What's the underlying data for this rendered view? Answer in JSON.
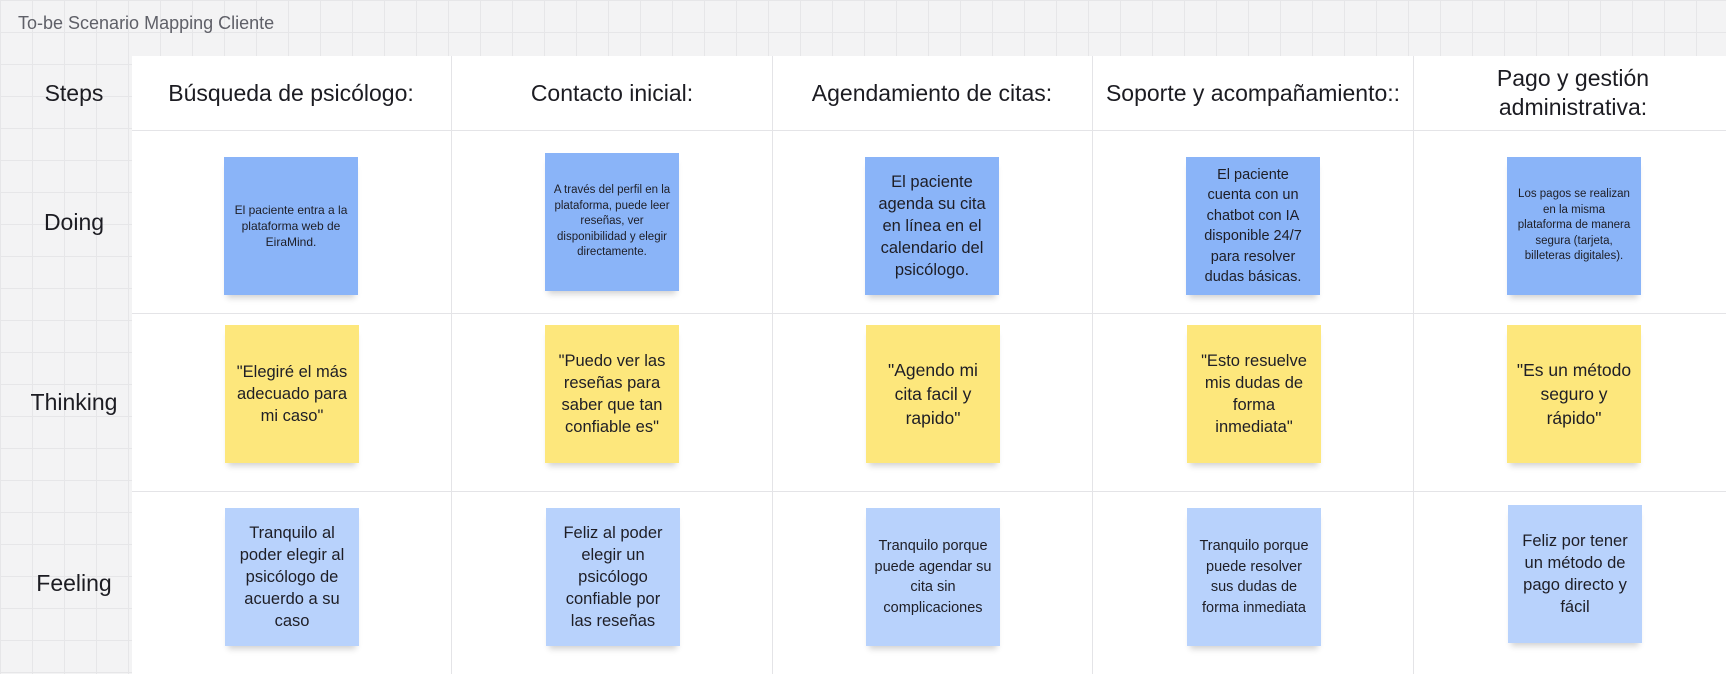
{
  "board": {
    "title": "To-be Scenario Mapping Cliente"
  },
  "rows": {
    "steps": "Steps",
    "doing": "Doing",
    "thinking": "Thinking",
    "feeling": "Feeling"
  },
  "columns": [
    {
      "header": "Búsqueda de psicólogo:",
      "doing": "El paciente entra a la plataforma web de EiraMind.",
      "thinking": "\"Elegiré el más adecuado para mi caso\"",
      "feeling": "Tranquilo al poder elegir al psicólogo de acuerdo a su caso"
    },
    {
      "header": "Contacto inicial:",
      "doing": "A través del perfil en la plataforma, puede leer reseñas, ver disponibilidad y elegir directamente.",
      "thinking": "\"Puedo ver las reseñas para saber que tan confiable es\"",
      "feeling": "Feliz al poder elegir un psicólogo confiable por las reseñas"
    },
    {
      "header": "Agendamiento de citas:",
      "doing": "El paciente agenda su cita en línea en el calendario del psicólogo.",
      "thinking": "\"Agendo mi cita facil y rapido\"",
      "feeling": "Tranquilo porque puede agendar su cita sin complicaciones"
    },
    {
      "header": "Soporte y acompañamiento::",
      "doing": "El paciente cuenta con un chatbot con IA disponible 24/7 para resolver dudas básicas.",
      "thinking": "\"Esto resuelve mis dudas de forma inmediata\"",
      "feeling": "Tranquilo porque puede resolver sus dudas de forma inmediata"
    },
    {
      "header": "Pago y gestión administrativa:",
      "doing": "Los pagos se realizan en la misma plataforma de manera segura (tarjeta, billeteras digitales).",
      "thinking": "\"Es un método seguro y rápido\"",
      "feeling": "Feliz por tener un método de pago directo y fácil"
    }
  ],
  "colors": {
    "doing_note": "#8ab4f8",
    "thinking_note": "#fde77c",
    "feeling_note": "#b8d2fc",
    "panel": "#ffffff",
    "canvas": "#f3f3f4"
  }
}
